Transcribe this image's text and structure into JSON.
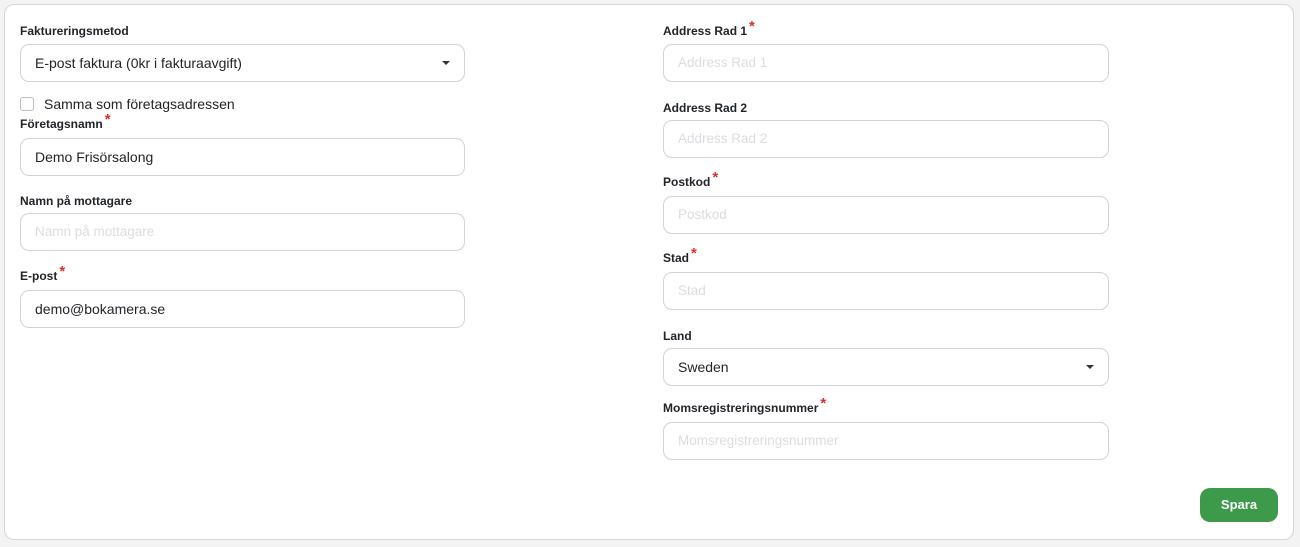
{
  "left": {
    "billing_method": {
      "label": "Faktureringsmetod",
      "value": "E-post faktura (0kr i fakturaavgift)"
    },
    "same_as_company": {
      "label": "Samma som företagsadressen",
      "checked": false
    },
    "company_name": {
      "label": "Företagsnamn",
      "required": "*",
      "value": "Demo Frisörsalong"
    },
    "recipient_name": {
      "label": "Namn på mottagare",
      "placeholder": "Namn på mottagare"
    },
    "email": {
      "label": "E-post",
      "required": "*",
      "value": "demo@bokamera.se"
    }
  },
  "right": {
    "address1": {
      "label": "Address Rad 1",
      "required": "*",
      "placeholder": "Address Rad 1"
    },
    "address2": {
      "label": "Address Rad 2",
      "placeholder": "Address Rad 2"
    },
    "postal_code": {
      "label": "Postkod",
      "required": "*",
      "placeholder": "Postkod"
    },
    "city": {
      "label": "Stad",
      "required": "*",
      "placeholder": "Stad"
    },
    "country": {
      "label": "Land",
      "value": "Sweden"
    },
    "vat_number": {
      "label": "Momsregistreringsnummer",
      "required": "*",
      "placeholder": "Momsregistreringsnummer"
    }
  },
  "actions": {
    "save_label": "Spara"
  },
  "colors": {
    "required": "#d9302c",
    "save_button": "#3d9a4a"
  },
  "icons": {
    "select_caret": "chevron-down-icon"
  }
}
